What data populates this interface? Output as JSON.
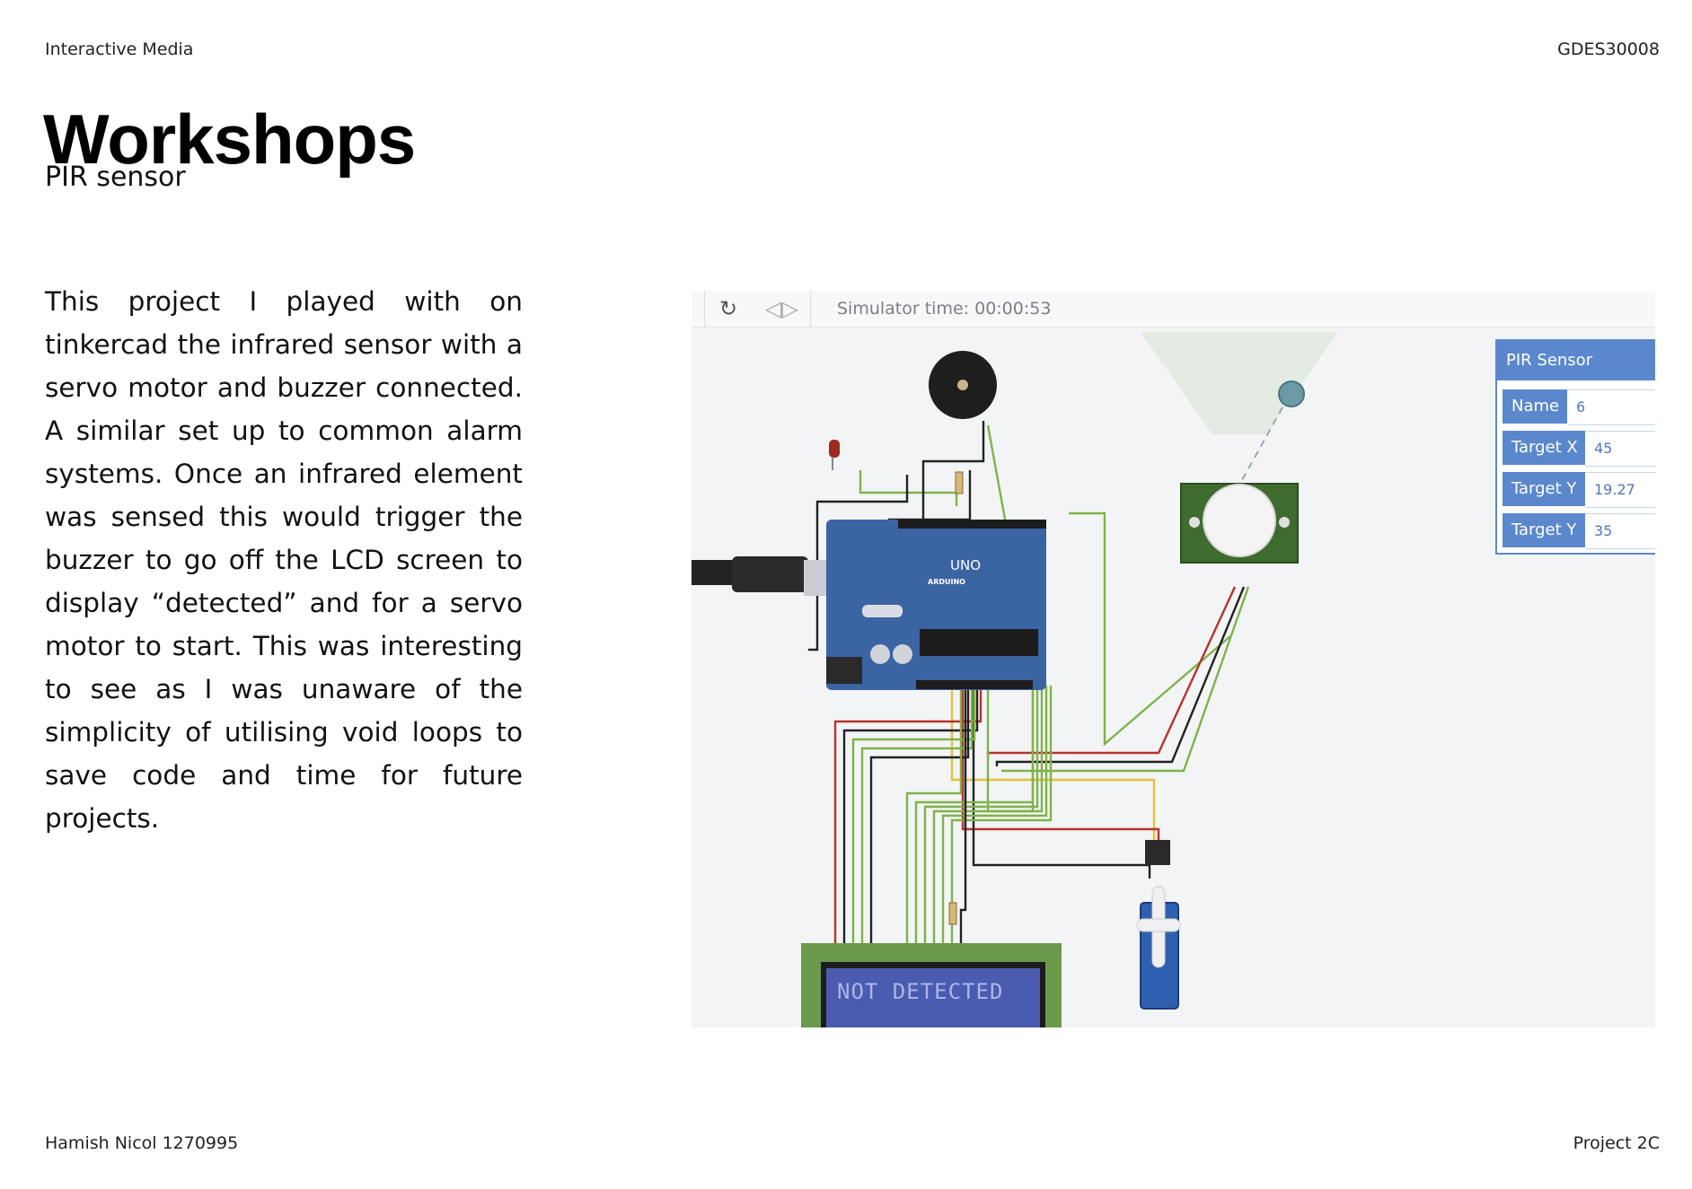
{
  "header": {
    "course": "Interactive Media",
    "code": "GDES30008"
  },
  "title": "Workshops",
  "subtitle": "PIR sensor",
  "body": "This project I played with on tinkercad the infrared sensor with a servo motor and buzzer connected. A similar set up to common alarm systems. Once an infrared element was sensed this would trigger the buzzer to go off the LCD screen to display “detected” and for a servo motor to start. This was interesting to see as I was unaware of the simplicity of utilising void loops to save code and time for future projects.",
  "footer": {
    "author": "Hamish Nicol 1270995",
    "project": "Project 2C"
  },
  "simulator": {
    "time_label": "Simulator time: 00:00:53",
    "lcd_text": "NOT DETECTED",
    "board_label": "UNO",
    "board_brand": "ARDUINO",
    "pir_panel": {
      "title": "PIR Sensor",
      "rows": [
        {
          "label": "Name",
          "value": "6"
        },
        {
          "label": "Target X",
          "value": "45"
        },
        {
          "label": "Target Y",
          "value": "19.27"
        },
        {
          "label": "Target Y",
          "value": "35"
        }
      ]
    }
  },
  "colors": {
    "board": "#3b64a3",
    "panel_accent": "#5b88cc",
    "lcd_bg": "#4a5bb0",
    "wire_green": "#7fb34a",
    "wire_red": "#b5352c",
    "wire_yellow": "#e3c23c",
    "wire_black": "#222222"
  }
}
